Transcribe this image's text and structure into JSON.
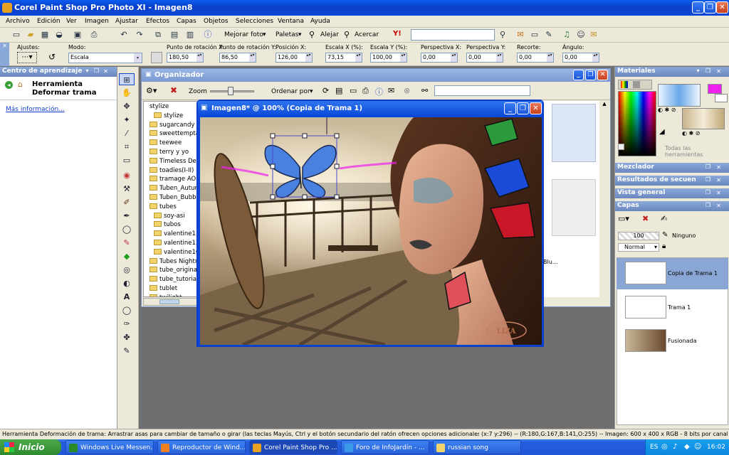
{
  "window": {
    "title": "Corel Paint Shop Pro Photo XI - Imagen8"
  },
  "menu": [
    "Archivo",
    "Edición",
    "Ver",
    "Imagen",
    "Ajustar",
    "Efectos",
    "Capas",
    "Objetos",
    "Selecciones",
    "Ventana",
    "Ayuda"
  ],
  "toolbar": {
    "enhance_photo": "Mejorar foto",
    "palettes": "Paletas",
    "zoom_out": "Alejar",
    "zoom_in": "Acercar"
  },
  "tool_options": {
    "presets_label": "Ajustes:",
    "mode_label": "Modo:",
    "mode_value": "Escala",
    "pivot_x_label": "Punto de rotación X:",
    "pivot_x": "180,50",
    "pivot_y_label": "Punto de rotación Y:",
    "pivot_y": "86,50",
    "pos_x_label": "Posición X:",
    "pos_x": "126,00",
    "scale_x_label": "Escala X (%):",
    "scale_x": "73,15",
    "scale_y_label": "Escala Y (%):",
    "scale_y": "100,00",
    "persp_x_label": "Perspectiva X:",
    "persp_x": "0,00",
    "persp_y_label": "Perspectiva Y:",
    "persp_y": "0,00",
    "shear_label": "Recorte:",
    "shear": "0,00",
    "angle_label": "Ángulo:",
    "angle": "0,00"
  },
  "learning": {
    "title": "Centro de aprendizaje",
    "tool_name_1": "Herramienta",
    "tool_name_2": "Deformar trama",
    "more_info": "Más información..."
  },
  "organizer": {
    "title": "Organizador",
    "zoom_label": "Zoom",
    "sort_label": "Ordenar por",
    "folders": [
      {
        "name": "stylize",
        "sub": false,
        "icon": false
      },
      {
        "name": "stylize",
        "sub": true,
        "icon": true
      },
      {
        "name": "sugarcandy",
        "sub": false,
        "icon": true
      },
      {
        "name": "sweettemptation",
        "sub": false,
        "icon": true
      },
      {
        "name": "teewee",
        "sub": false,
        "icon": true
      },
      {
        "name": "terry y yo",
        "sub": false,
        "icon": true
      },
      {
        "name": "Timeless Definitio",
        "sub": false,
        "icon": true
      },
      {
        "name": "toadies(I-II)",
        "sub": false,
        "icon": true
      },
      {
        "name": "tramage AORA",
        "sub": false,
        "icon": true
      },
      {
        "name": "Tuben_AutumnM",
        "sub": false,
        "icon": true
      },
      {
        "name": "Tuben_BubbleDr",
        "sub": false,
        "icon": true
      },
      {
        "name": "tubes",
        "sub": false,
        "icon": true
      },
      {
        "name": "soy-asi",
        "sub": true,
        "icon": true
      },
      {
        "name": "tubos",
        "sub": true,
        "icon": true
      },
      {
        "name": "valentine11",
        "sub": true,
        "icon": true
      },
      {
        "name": "valentine13",
        "sub": true,
        "icon": true
      },
      {
        "name": "valentine16",
        "sub": true,
        "icon": true
      },
      {
        "name": "Tubes Nightmare",
        "sub": false,
        "icon": true
      },
      {
        "name": "tube_originali",
        "sub": false,
        "icon": true
      },
      {
        "name": "tube_tutorial_na",
        "sub": false,
        "icon": true
      },
      {
        "name": "tublet",
        "sub": false,
        "icon": true
      },
      {
        "name": "twilight",
        "sub": false,
        "icon": true
      }
    ],
    "thumb_caption": "Blu..."
  },
  "image_window": {
    "title": "Imagen8* @ 100% (Copia de Trama 1)",
    "watermark": "LIZA"
  },
  "materials": {
    "title": "Materiales",
    "all_tools": "Todas las herramientas"
  },
  "panels": {
    "mixer": "Mezclador",
    "history": "Resultados de secuen",
    "overview": "Vista general",
    "layers": "Capas"
  },
  "layers": {
    "opacity": "100",
    "mask": "Ninguno",
    "blend": "Normal",
    "items": [
      {
        "name": "Copia de Trama 1",
        "selected": true
      },
      {
        "name": "Trama 1",
        "selected": false
      },
      {
        "name": "Fusionada",
        "selected": false
      }
    ]
  },
  "status": {
    "hint": "Herramienta Deformación de trama: Arrastrar asas para cambiar de tamaño o girar (las teclas Mayús, Ctrl y el botón secundario del ratón ofrecen opciones adicionales).",
    "info": "(x:7 y:296) -- (R:180,G:167,B:141,O:255) -- Imagen: 600 x 400 x RGB - 8 bits por canal"
  },
  "taskbar": {
    "start": "Inicio",
    "tasks": [
      {
        "label": "Windows Live Messen..."
      },
      {
        "label": "Reproductor de Wind..."
      },
      {
        "label": "Corel Paint Shop Pro ..."
      },
      {
        "label": "Foro de InfoJardín - ..."
      },
      {
        "label": "russian song"
      }
    ],
    "tray_lang": "ES",
    "clock": "16:02"
  },
  "colors": {
    "titlebar": "#0a48d8",
    "workspace": "#6f6f6f",
    "accent": "#f020f0"
  }
}
